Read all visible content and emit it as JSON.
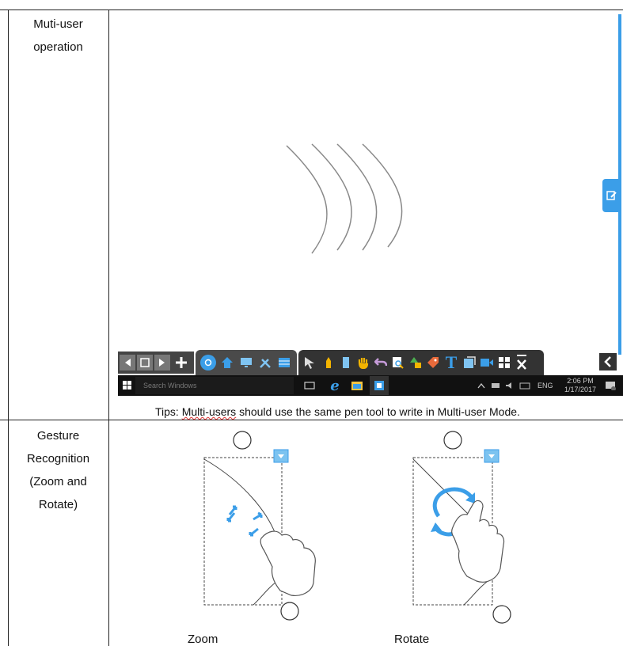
{
  "rows": [
    {
      "label_lines": [
        "Muti-user",
        "operation"
      ],
      "tips_prefix": "Tips: ",
      "tips_underlined": "Multi-users",
      "tips_suffix": " should use the same pen tool to write in Multi-user Mode."
    },
    {
      "label_lines": [
        "Gesture",
        "Recognition",
        "(Zoom and",
        "Rotate)"
      ],
      "captions": [
        "Zoom",
        "Rotate"
      ]
    }
  ],
  "screen": {
    "taskbar": {
      "search_placeholder": "Search Windows",
      "language": "ENG",
      "time": "2:06 PM",
      "date": "1/17/2017"
    },
    "toolbar_icons_left": [
      "prev-page-icon",
      "page-view-icon",
      "next-page-icon",
      "add-page-icon"
    ],
    "toolbar_icons_middle": [
      "app-logo-icon",
      "home-icon",
      "display-icon",
      "tools-icon",
      "window-icon"
    ],
    "toolbar_icons_right": [
      "select-arrow-icon",
      "pen-icon",
      "eraser-icon",
      "hand-icon",
      "undo-icon",
      "search-doc-icon",
      "shapes-icon",
      "tag-icon",
      "text-icon",
      "clip-icon",
      "camera-icon",
      "grid-icon",
      "close-icon"
    ],
    "accent_color": "#3b9ee8"
  }
}
